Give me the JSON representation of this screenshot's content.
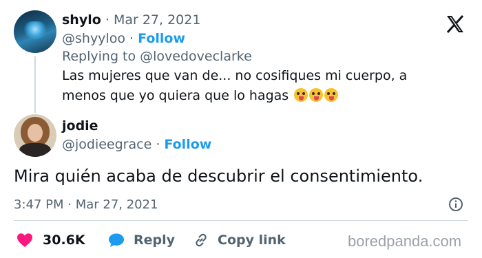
{
  "reply_tweet": {
    "display_name": "shylo",
    "dot": "·",
    "date": "Mar 27, 2021",
    "handle": "@shyyloo",
    "follow_label": "Follow",
    "replying_to": "Replying to @lovedoveclarke",
    "text": "Las mujeres que van de... no cosifiques mi cuerpo, a menos que yo quiera que lo hagas",
    "emojis": [
      "squinting-face-with-tongue",
      "squinting-face-with-tongue",
      "squinting-face-with-tongue"
    ]
  },
  "x_logo_icon": "x-logo-icon",
  "main_tweet": {
    "display_name": "jodie",
    "handle": "@jodieegrace",
    "dot": "·",
    "follow_label": "Follow",
    "text": "Mira quién acaba de descubrir el consentimiento.",
    "time": "3:47 PM · Mar 27, 2021"
  },
  "actions": {
    "likes": "30.6K",
    "reply_label": "Reply",
    "copy_link_label": "Copy link"
  },
  "watermark": "boredpanda.com",
  "colors": {
    "accent": "#1d9bf0",
    "like": "#f91880",
    "muted": "#536471"
  }
}
